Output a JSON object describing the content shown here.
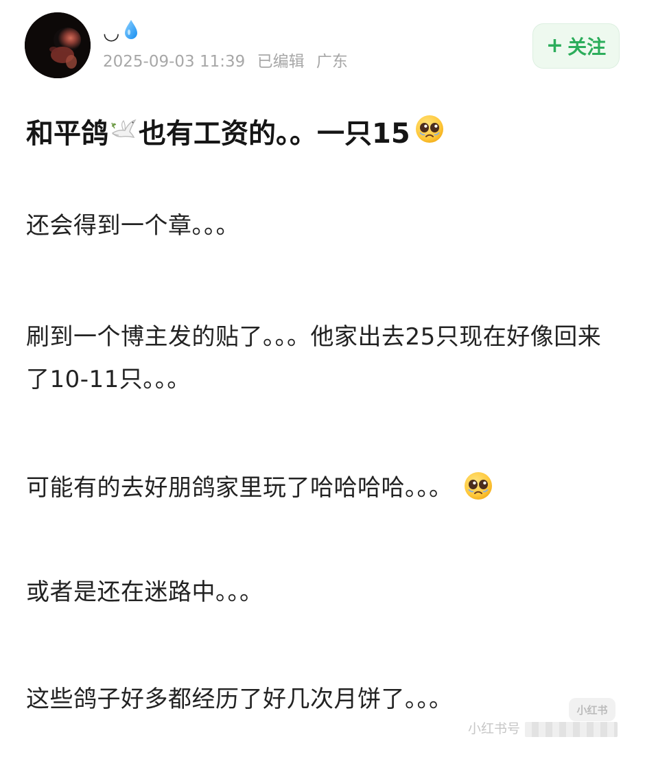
{
  "header": {
    "username": "◡",
    "date": "2025-09-03 11:39",
    "edited": "已编辑",
    "location": "广东",
    "follow_label": "关注"
  },
  "post": {
    "title_part1": "和平鸽",
    "title_part2": "也有工资的。。一只15",
    "paragraphs": [
      "还会得到一个章。。。",
      "刷到一个博主发的贴了。。。他家出去25只现在好像回来了10-11只。。。",
      "可能有的去好朋鸽家里玩了哈哈哈哈。。。",
      "或者是还在迷路中。。。",
      "这些鸽子好多都经历了好几次月饼了。。。"
    ]
  },
  "watermark": {
    "badge": "小红书",
    "text": "小红书号"
  },
  "icons": {
    "drop": "water-drop-icon",
    "dove": "dove-icon",
    "pleading": "pleading-face-icon",
    "plus": "plus-icon"
  },
  "colors": {
    "follow_text": "#2cad5b",
    "follow_background": "#eef9ef",
    "meta_text": "#a7a7a7"
  }
}
